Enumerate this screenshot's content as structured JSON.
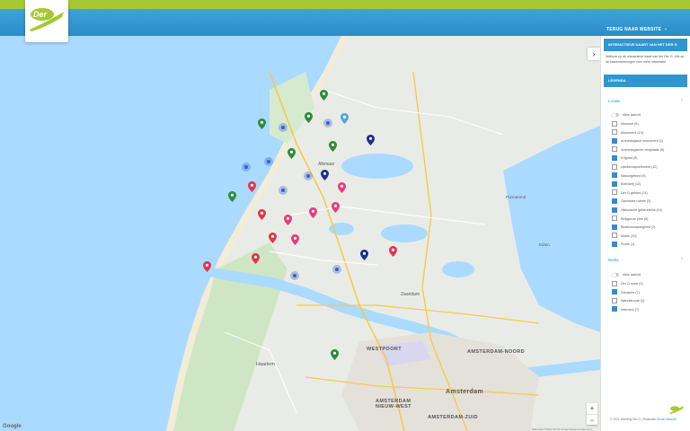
{
  "header": {
    "logo_text": "Der",
    "back_link": "TERUG NAAR WEBSITE"
  },
  "colors": {
    "topbar": "#a6c832",
    "header": "#2a8cc9",
    "water": "#aadaff",
    "pin_green": "#2e8b3a",
    "pin_navy": "#1f2d8a",
    "pin_red": "#e0344a",
    "pin_pink": "#e83a7a",
    "pin_lightblue": "#4aa8e0",
    "cluster_blue": "#3a5fcc"
  },
  "map": {
    "labels": [
      "WESTPOORT",
      "Amsterdam",
      "AMSTERDAM-NOORD",
      "AMSTERDAM NIEUW-WEST",
      "AMSTERDAM-ZUID",
      "Haarlem",
      "Zaandam",
      "Purmerend",
      "Alkmaar",
      "Edam"
    ],
    "zoom_in": "+",
    "zoom_out": "−",
    "google": "Google",
    "attribution": "Map data ©2024   Terms of Use   Report a map error",
    "collapse_icon": "chevron-right-icon"
  },
  "panel": {
    "title": "INTERACTIEVE KAART VAN HET DER G",
    "intro": "Welkom op de interactieve kaart van het Der G. Klik op de kaartmarkeringen voor meer informatie.",
    "legend_title": "LEGENDA",
    "locations": {
      "heading": "Locatie",
      "all_label": "Alles aan/uit",
      "items": [
        {
          "label": "Museum (6)",
          "checked": false
        },
        {
          "label": "Monument (13)",
          "checked": false
        },
        {
          "label": "Archeologisch monument (1)",
          "checked": true
        },
        {
          "label": "Archeologische vindplaats (5)",
          "checked": false
        },
        {
          "label": "Erfgoed (9)",
          "checked": true
        },
        {
          "label": "Landschapselement (12)",
          "checked": false
        },
        {
          "label": "Natuurgebied (9)",
          "checked": true
        },
        {
          "label": "Boerderij (12)",
          "checked": true
        },
        {
          "label": "Der G-gebied (24)",
          "checked": false
        },
        {
          "label": "Openbare ruimte (3)",
          "checked": true
        },
        {
          "label": "Historische gebeurtenis (10)",
          "checked": true
        },
        {
          "label": "Religieuze plek (8)",
          "checked": false
        },
        {
          "label": "Bezienswaardigheid (2)",
          "checked": true
        },
        {
          "label": "Molen (10)",
          "checked": false
        },
        {
          "label": "Route (1)",
          "checked": true
        }
      ]
    },
    "media": {
      "heading": "Media",
      "all_label": "Alles aan/uit",
      "items": [
        {
          "label": "Der G route (2)",
          "checked": false
        },
        {
          "label": "Fotoserie (7)",
          "checked": true
        },
        {
          "label": "Wandelroute (3)",
          "checked": false
        },
        {
          "label": "Interview (7)",
          "checked": true
        }
      ]
    },
    "footer": "© 2021 Stichting Der G | Realisatie",
    "footer_link": "Studio Waarde"
  }
}
